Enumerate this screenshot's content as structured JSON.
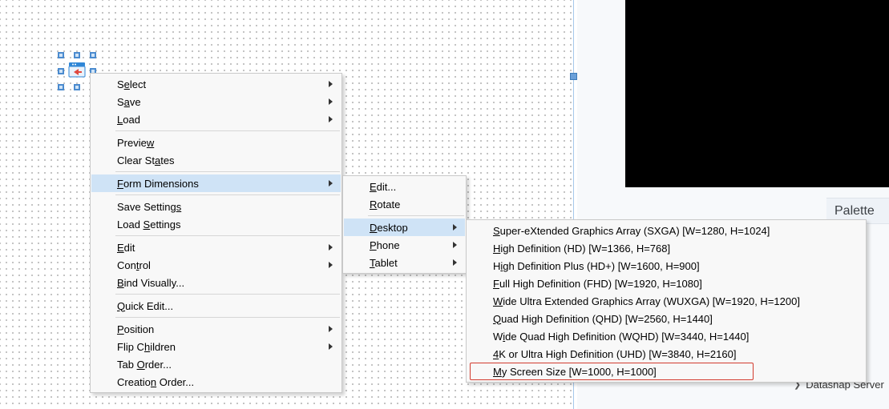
{
  "palette": {
    "title": "Palette",
    "item": "Datasnap Server"
  },
  "ctx": {
    "select": "Select",
    "save": "Save",
    "load": "Load",
    "preview": "Preview",
    "clearStates": "Clear States",
    "formDimensions": "Form Dimensions",
    "saveSettings": "Save Settings",
    "loadSettings": "Load Settings",
    "edit": "Edit",
    "control": "Control",
    "bindVisually": "Bind Visually...",
    "quickEdit": "Quick Edit...",
    "position": "Position",
    "flipChildren": "Flip Children",
    "tabOrder": "Tab Order...",
    "creationOrder": "Creation Order..."
  },
  "formdim": {
    "edit": "Edit...",
    "rotate": "Rotate",
    "desktop": "Desktop",
    "phone": "Phone",
    "tablet": "Tablet"
  },
  "desktop": {
    "sxga": "Super-eXtended Graphics Array (SXGA)  [W=1280, H=1024]",
    "hd": "High Definition (HD)  [W=1366, H=768]",
    "hdp": "High Definition Plus (HD+)  [W=1600, H=900]",
    "fhd": "Full High Definition (FHD)  [W=1920, H=1080]",
    "wuxga": "Wide Ultra Extended Graphics Array (WUXGA)  [W=1920, H=1200]",
    "qhd": "Quad High Definition (QHD)  [W=2560, H=1440]",
    "wqhd": "Wide Quad High Definition (WQHD)  [W=3440, H=1440]",
    "uhd": "4K or Ultra High Definition (UHD)  [W=3840, H=2160]",
    "mine": "My Screen Size  [W=1000, H=1000]"
  }
}
